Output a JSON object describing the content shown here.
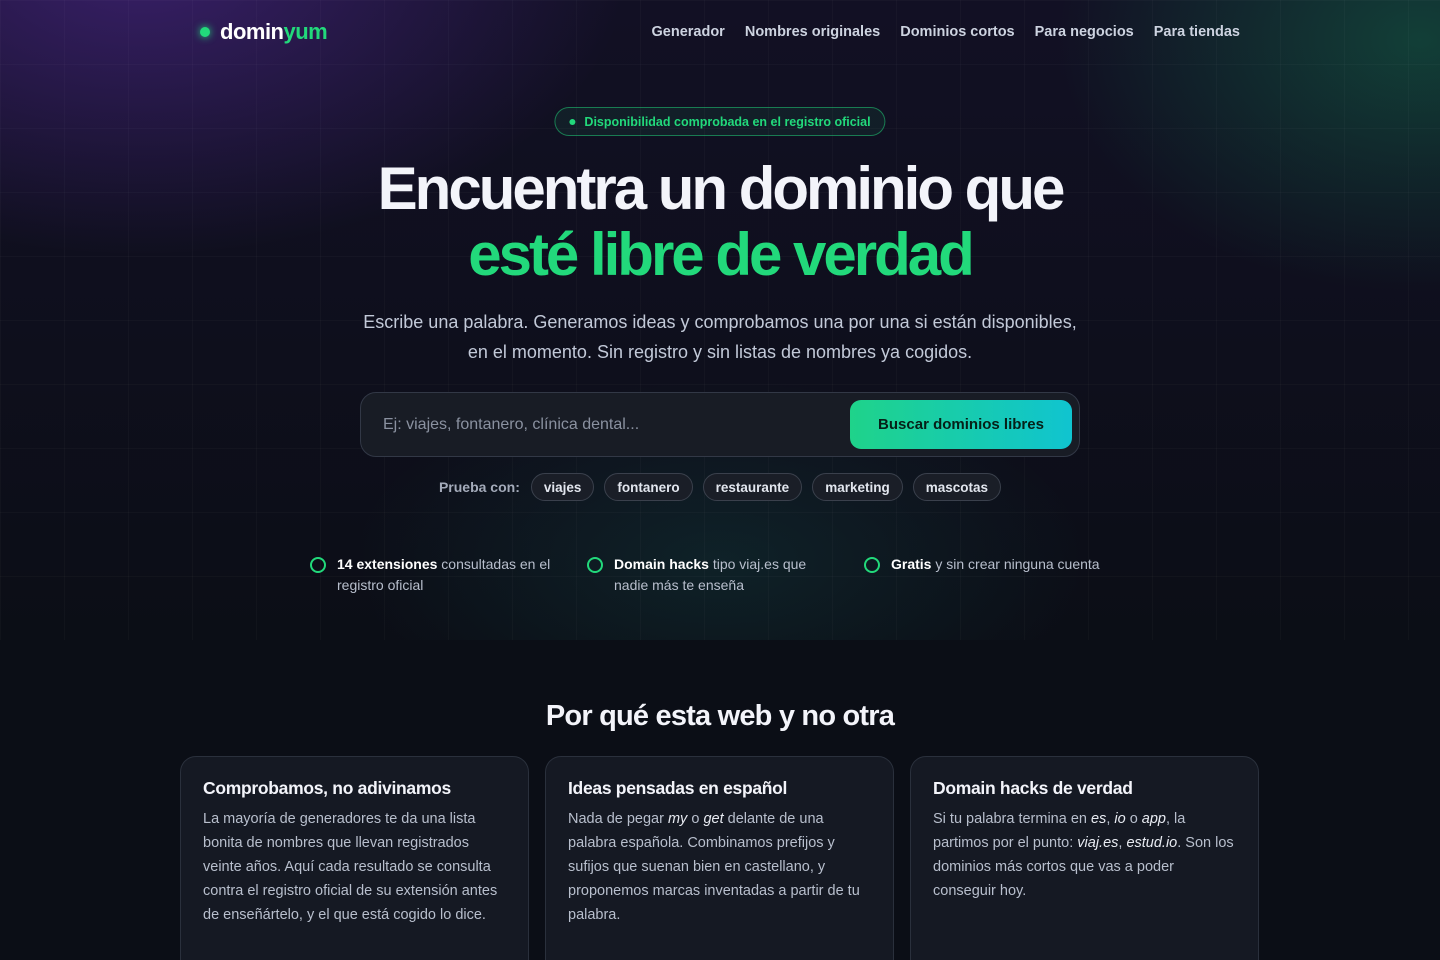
{
  "brand": {
    "name_part1": "domin",
    "name_part2": "yum",
    "accent": "#22d97b"
  },
  "nav": {
    "links": [
      "Generador",
      "Nombres originales",
      "Dominios cortos",
      "Para negocios",
      "Para tiendas"
    ]
  },
  "hero": {
    "badge": "Disponibilidad comprobada en el registro oficial",
    "title_line1": "Encuentra un dominio que",
    "title_line2": "esté libre de verdad",
    "subtitle_line1": "Escribe una palabra. Generamos ideas y comprobamos una por una si están disponibles,",
    "subtitle_line2": "en el momento. Sin registro y sin listas de nombres ya cogidos."
  },
  "search": {
    "placeholder": "Ej: viajes, fontanero, clínica dental...",
    "value": "",
    "button_label": "Buscar dominios libres"
  },
  "suggestions": {
    "label": "Prueba con:",
    "chips": [
      "viajes",
      "fontanero",
      "restaurante",
      "marketing",
      "mascotas"
    ]
  },
  "features": [
    {
      "bold": "14 extensiones",
      "text": " consultadas en el registro oficial"
    },
    {
      "bold": "Domain hacks",
      "text": " tipo viaj.es que nadie más te enseña"
    },
    {
      "bold": "Gratis",
      "text": " y sin crear ninguna cuenta"
    }
  ],
  "why": {
    "title": "Por qué esta web y no otra",
    "cards": [
      {
        "title": "Comprobamos, no adivinamos",
        "body": "La mayoría de generadores te da una lista bonita de nombres que llevan registrados veinte años. Aquí cada resultado se consulta contra el registro oficial de su extensión antes de enseñártelo, y el que está cogido lo dice."
      },
      {
        "title": "Ideas pensadas en español",
        "body_parts": [
          "Nada de pegar ",
          "my",
          " o ",
          "get",
          " delante de una palabra española. Combinamos prefijos y sufijos que suenan bien en castellano, y proponemos marcas inventadas a partir de tu palabra."
        ]
      },
      {
        "title": "Domain hacks de verdad",
        "body_parts": [
          "Si tu palabra termina en ",
          "es",
          ", ",
          "io",
          " o ",
          "app",
          ", la partimos por el punto: ",
          "viaj.es",
          ", ",
          "estud.io",
          ". Son los dominios más cortos que vas a poder conseguir hoy."
        ]
      }
    ]
  }
}
